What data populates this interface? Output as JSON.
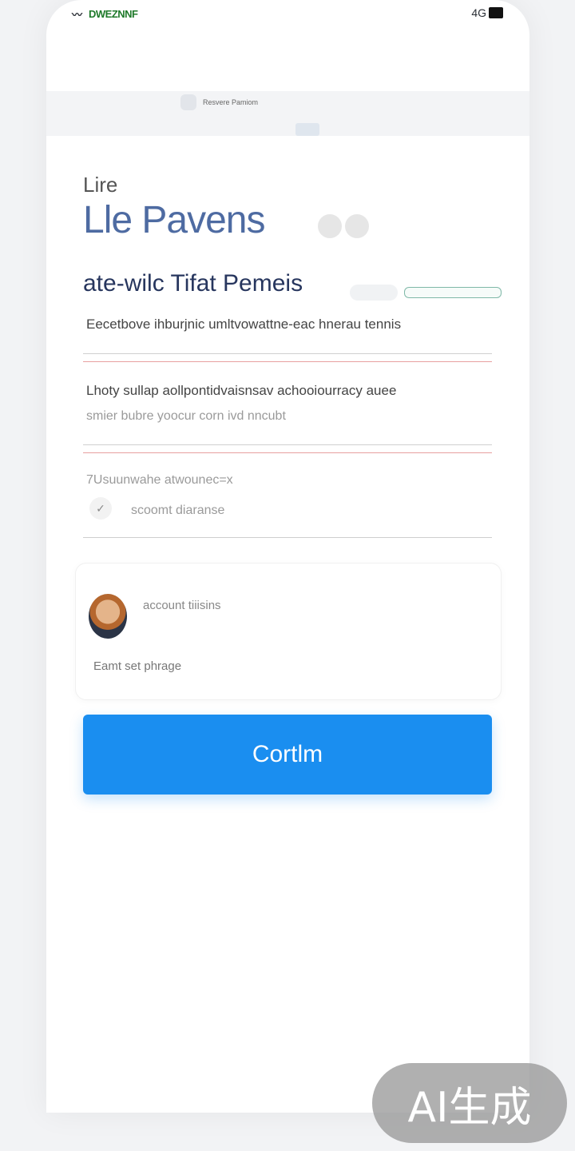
{
  "status_bar": {
    "left_icon": "signal-icon",
    "carrier": "DWEZNNF",
    "right_text": "4G",
    "battery_icon": "battery-icon"
  },
  "browser": {
    "url_text": "Resvere Pamiom"
  },
  "heading": {
    "kicker": "Lire",
    "hero": "Lle Pavens",
    "subtitle": "ate-wilc Tifat Pemeis"
  },
  "fields": [
    {
      "text": "Eecetbove ihburjnic umltvowattne-eac hnerau tennis"
    },
    {
      "text": "Lhoty sullap aollpontidvaisnsav achooiourracy auee"
    },
    {
      "text": "smier bubre yoocur corn ivd nncubt"
    },
    {
      "text": "7Usuunwahe atwounec=x"
    },
    {
      "text": "scoomt diaranse"
    }
  ],
  "account_card": {
    "account_label": "account tiiisins",
    "phrase_label": "Eamt set phrage"
  },
  "confirm_button": {
    "label": "Cortlm"
  },
  "watermark": {
    "text": "AI生成"
  }
}
